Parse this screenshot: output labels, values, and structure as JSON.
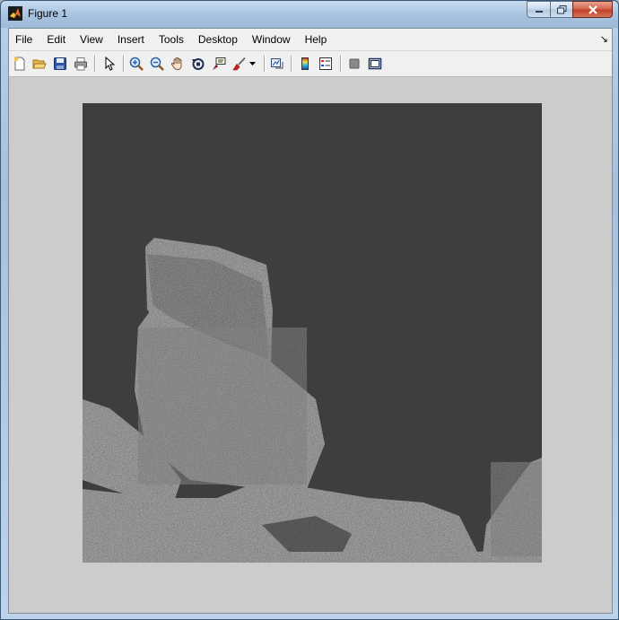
{
  "window": {
    "title": "Figure 1",
    "icon": "matlab-logo-icon"
  },
  "menubar": {
    "items": [
      "File",
      "Edit",
      "View",
      "Insert",
      "Tools",
      "Desktop",
      "Window",
      "Help"
    ],
    "dock_glyph": "↘"
  },
  "toolbar": {
    "buttons": [
      "new-figure-icon",
      "open-file-icon",
      "save-figure-icon",
      "print-figure-icon",
      "edit-plot-icon",
      "zoom-in-icon",
      "zoom-out-icon",
      "pan-icon",
      "rotate-3d-icon",
      "data-cursor-icon",
      "brush-icon",
      "link-plot-icon",
      "insert-colorbar-icon",
      "insert-legend-icon",
      "hide-plot-tools-icon",
      "show-plot-tools-icon"
    ]
  },
  "figure": {
    "image": "grayscale-rock-boulders-image",
    "background_color": "#3e3e3e",
    "figure_color": "#cccccc"
  }
}
